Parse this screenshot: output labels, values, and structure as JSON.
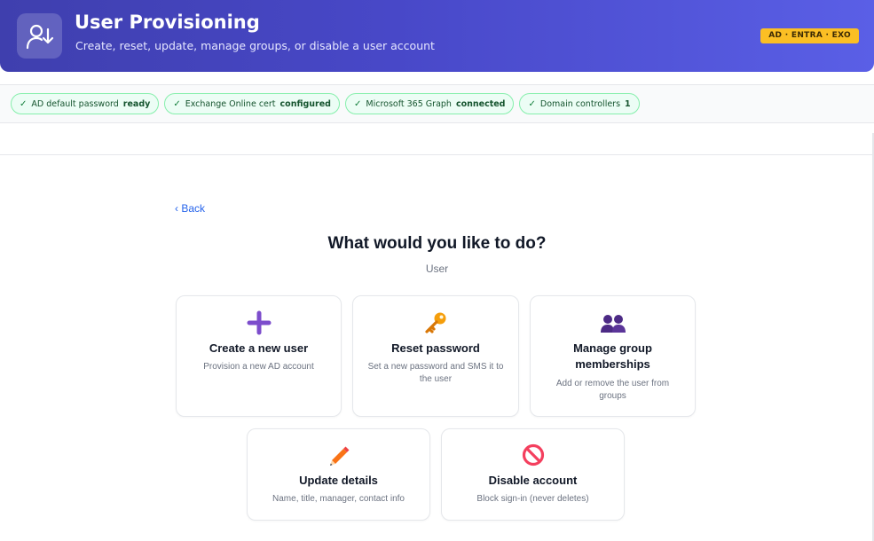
{
  "header": {
    "title": "User Provisioning",
    "subtitle": "Create, reset, update, manage groups, or disable a user account",
    "badge": "AD · ENTRA · EXO",
    "icon": "user-download-icon"
  },
  "status": [
    {
      "label": "AD default password",
      "value": "ready"
    },
    {
      "label": "Exchange Online cert",
      "value": "configured"
    },
    {
      "label": "Microsoft 365 Graph",
      "value": "connected"
    },
    {
      "label": "Domain controllers",
      "value": "1"
    }
  ],
  "status_check": "✓",
  "nav": {
    "back": "‹ Back"
  },
  "main": {
    "title": "What would you like to do?",
    "subtitle": "User"
  },
  "actions": [
    {
      "title": "Create a new user",
      "desc": "Provision a new AD account",
      "icon": "plus-icon",
      "color": "#7c4dcc"
    },
    {
      "title": "Reset password",
      "desc": "Set a new password and SMS it to the user",
      "icon": "key-icon",
      "color": "#f59e0b"
    },
    {
      "title": "Manage group memberships",
      "desc": "Add or remove the user from groups",
      "icon": "people-icon",
      "color": "#4c2a85"
    },
    {
      "title": "Update details",
      "desc": "Name, title, manager, contact info",
      "icon": "pencil-icon",
      "color": "#f97316"
    },
    {
      "title": "Disable account",
      "desc": "Block sign-in (never deletes)",
      "icon": "prohibited-icon",
      "color": "#f43f5e"
    }
  ],
  "colors": {
    "header": "#4848c8",
    "badge": "#fbbf24",
    "accent": "#2563eb",
    "ok": "#15803d"
  }
}
